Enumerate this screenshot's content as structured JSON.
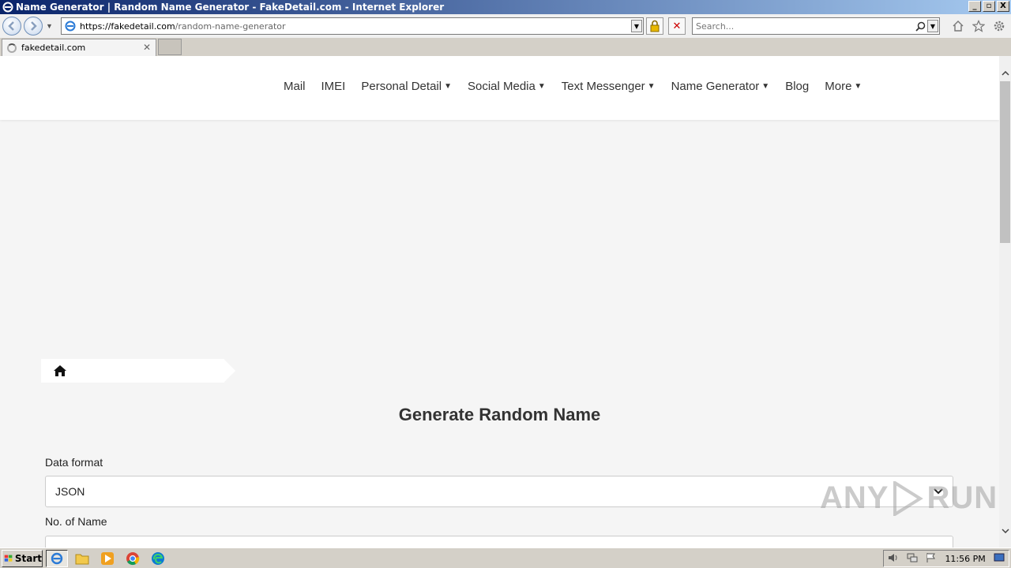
{
  "window": {
    "title": "Name Generator | Random Name Generator - FakeDetail.com - Internet Explorer",
    "controls": [
      "_",
      "▫",
      "X"
    ]
  },
  "address_bar": {
    "url_host": "https://fakedetail.com",
    "url_path": "/random-name-generator"
  },
  "search": {
    "placeholder": "Search..."
  },
  "tab": {
    "label": "fakedetail.com"
  },
  "site": {
    "menu": [
      {
        "label": "Mail",
        "has_dropdown": false
      },
      {
        "label": "IMEI",
        "has_dropdown": false
      },
      {
        "label": "Personal Detail",
        "has_dropdown": true
      },
      {
        "label": "Social Media",
        "has_dropdown": true
      },
      {
        "label": "Text Messenger",
        "has_dropdown": true
      },
      {
        "label": "Name Generator",
        "has_dropdown": true
      },
      {
        "label": "Blog",
        "has_dropdown": false
      },
      {
        "label": "More",
        "has_dropdown": true
      }
    ],
    "heading": "Generate Random Name",
    "form": {
      "data_format_label": "Data format",
      "data_format_value": "JSON",
      "count_label": "No. of Name",
      "count_value": ""
    },
    "watermark": "ANY RUN"
  },
  "taskbar": {
    "start_label": "Start",
    "apps": [
      "internet-explorer",
      "file-explorer",
      "media-player",
      "chrome",
      "edge"
    ],
    "clock": "11:56 PM"
  }
}
